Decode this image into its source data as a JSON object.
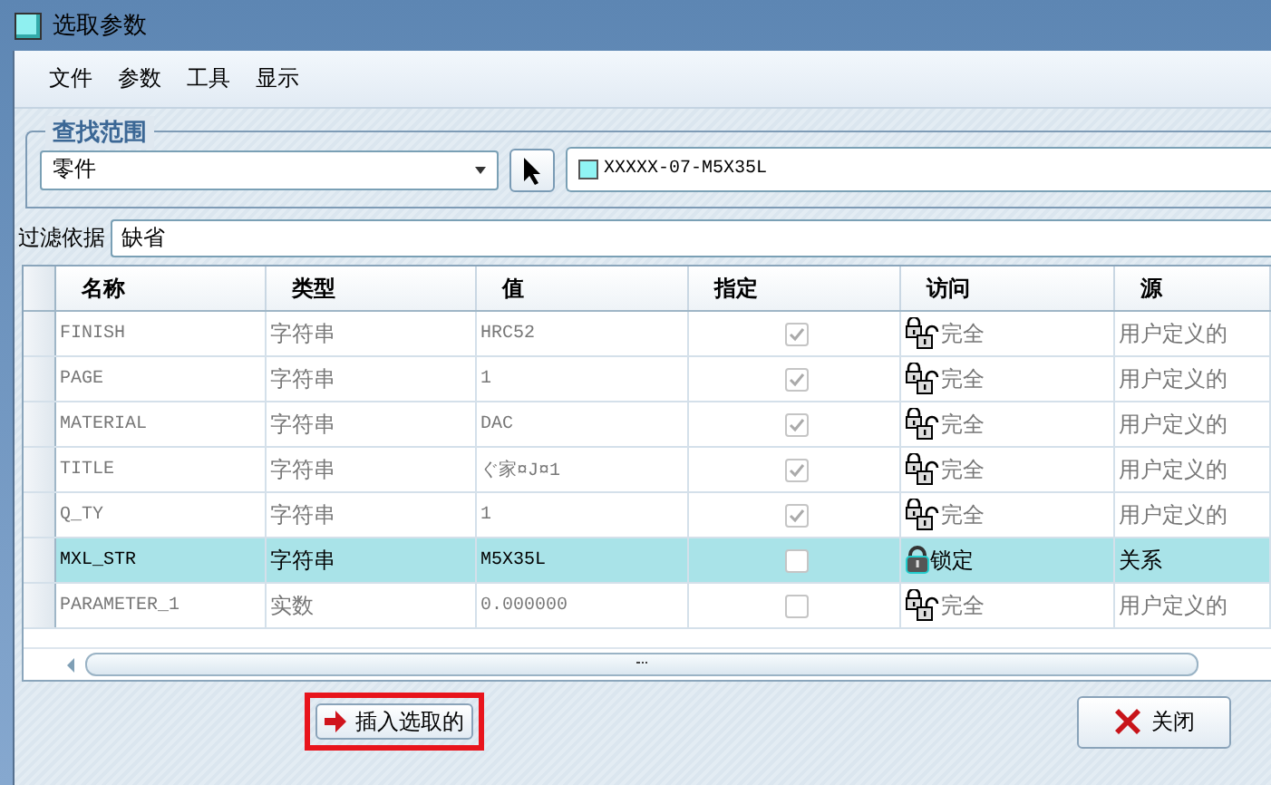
{
  "window": {
    "title": "选取参数"
  },
  "menu": [
    {
      "label": "文件"
    },
    {
      "label": "参数"
    },
    {
      "label": "工具"
    },
    {
      "label": "显示"
    }
  ],
  "search_scope": {
    "legend": "查找范围",
    "scope_value": "零件",
    "model": "XXXXX-07-M5X35L"
  },
  "filter": {
    "label": "过滤依据",
    "value": "缺省"
  },
  "table": {
    "columns": [
      "名称",
      "类型",
      "值",
      "指定",
      "访问",
      "源"
    ],
    "rows": [
      {
        "name": "FINISH",
        "type": "字符串",
        "value": "HRC52",
        "assigned": true,
        "kind": "full",
        "access": "完全",
        "source": "用户定义的",
        "selected": false
      },
      {
        "name": "PAGE",
        "type": "字符串",
        "value": "1",
        "assigned": true,
        "kind": "full",
        "access": "完全",
        "source": "用户定义的",
        "selected": false
      },
      {
        "name": "MATERIAL",
        "type": "字符串",
        "value": "DAC",
        "assigned": true,
        "kind": "full",
        "access": "完全",
        "source": "用户定义的",
        "selected": false
      },
      {
        "name": "TITLE",
        "type": "字符串",
        "value": "ぐ家¤J¤1",
        "assigned": true,
        "kind": "full",
        "access": "完全",
        "source": "用户定义的",
        "selected": false
      },
      {
        "name": "Q_TY",
        "type": "字符串",
        "value": "1",
        "assigned": true,
        "kind": "full",
        "access": "完全",
        "source": "用户定义的",
        "selected": false
      },
      {
        "name": "MXL_STR",
        "type": "字符串",
        "value": "M5X35L",
        "assigned": false,
        "kind": "locked",
        "access": "锁定",
        "source": "关系",
        "selected": true
      },
      {
        "name": "PARAMETER_1",
        "type": "实数",
        "value": "0.000000",
        "assigned": false,
        "kind": "full",
        "access": "完全",
        "source": "用户定义的",
        "selected": false
      }
    ]
  },
  "buttons": {
    "insert": {
      "label": "插入选取的",
      "highlighted": true
    },
    "close": {
      "label": "关闭"
    }
  }
}
